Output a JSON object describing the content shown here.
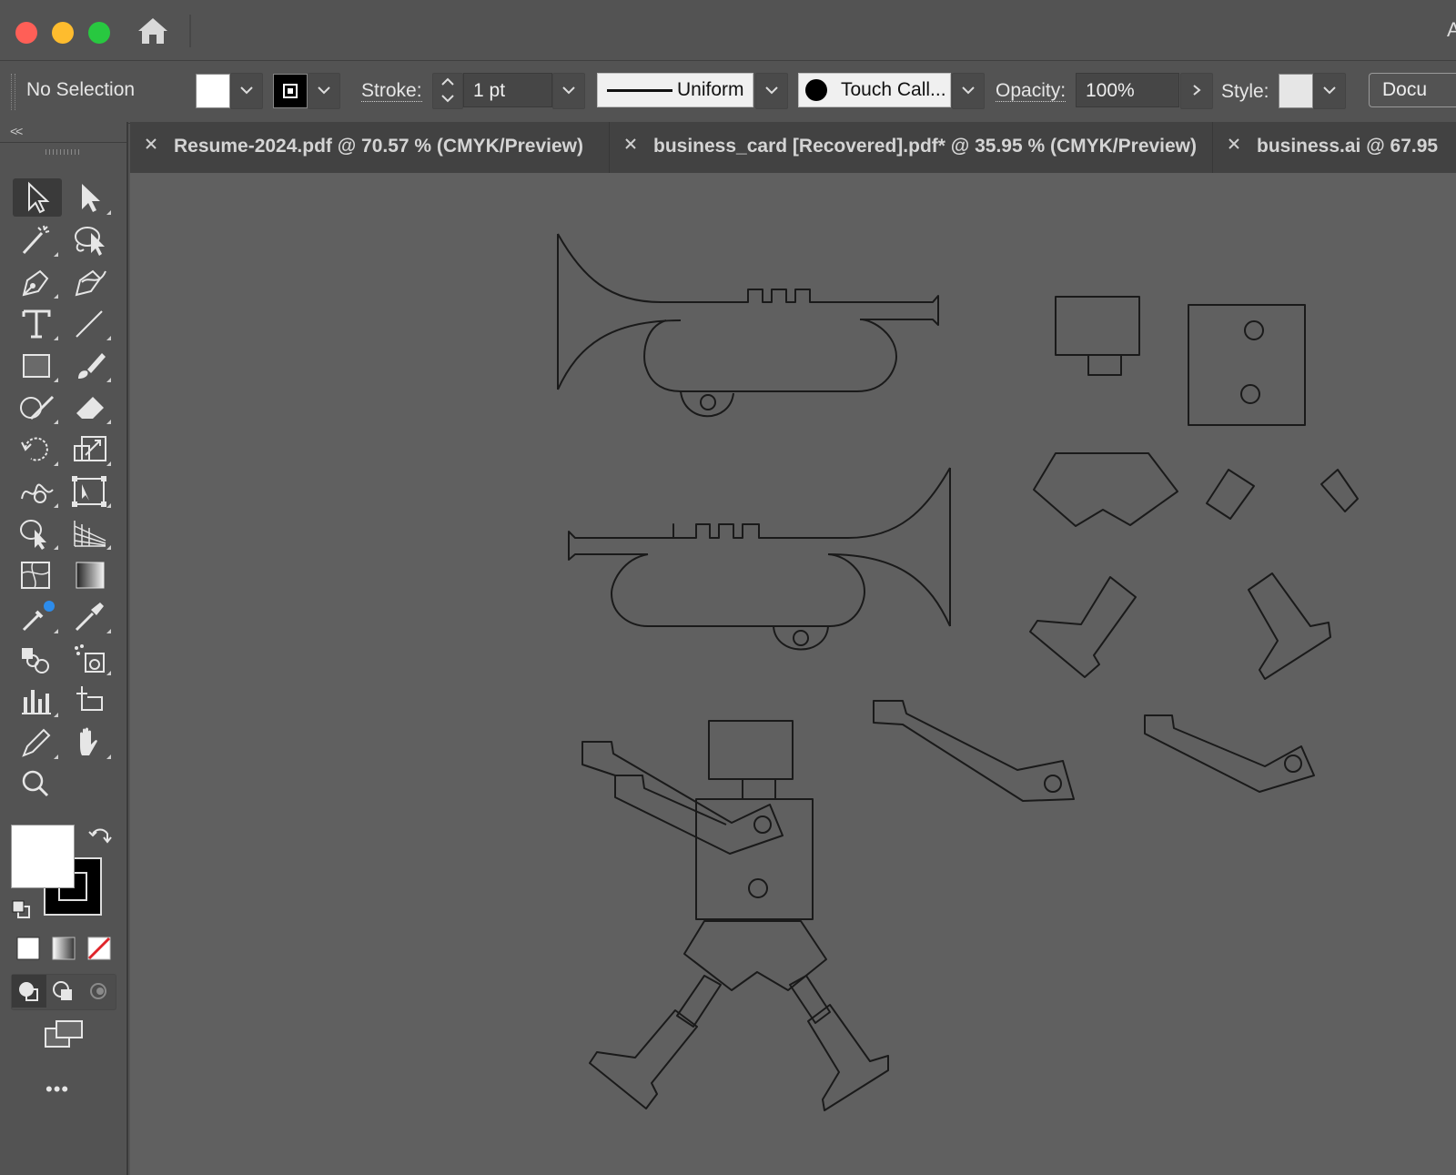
{
  "titlebar": {
    "home_icon": "home-icon",
    "edge_text": "A"
  },
  "control": {
    "selection_label": "No Selection",
    "stroke_label": "Stroke:",
    "stroke_value": "1 pt",
    "profile_label": "Uniform",
    "brush_label": "Touch Call...",
    "opacity_label": "Opacity:",
    "opacity_value": "100%",
    "style_label": "Style:",
    "document_button": "Docu"
  },
  "tabs": [
    {
      "label": "Resume-2024.pdf @ 70.57 % (CMYK/Preview)"
    },
    {
      "label": "business_card [Recovered].pdf* @ 35.95 % (CMYK/Preview)"
    },
    {
      "label": "business.ai @ 67.95"
    }
  ],
  "toolbar": {
    "collapse_label": "<<",
    "more_label": "•••",
    "tools": [
      "selection-tool-icon",
      "direct-selection-tool-icon",
      "magic-wand-tool-icon",
      "lasso-tool-icon",
      "pen-tool-icon",
      "curvature-tool-icon",
      "type-tool-icon",
      "line-segment-tool-icon",
      "rectangle-tool-icon",
      "paintbrush-tool-icon",
      "shaper-tool-icon",
      "eraser-tool-icon",
      "rotate-tool-icon",
      "scale-tool-icon",
      "warp-tool-icon",
      "free-transform-tool-icon",
      "shape-builder-tool-icon",
      "perspective-grid-tool-icon",
      "mesh-tool-icon",
      "gradient-tool-icon",
      "eyedropper-tool-icon",
      "measure-tool-icon",
      "blend-tool-icon",
      "symbol-sprayer-tool-icon",
      "column-graph-tool-icon",
      "artboard-tool-icon",
      "slice-tool-icon",
      "hand-tool-icon",
      "zoom-tool-icon"
    ]
  },
  "colors": {
    "app_bg": "#535353",
    "canvas_bg": "#606060",
    "tab_bar_bg": "#424242",
    "artwork_stroke": "#1a1a1a",
    "fill": "#ffffff",
    "stroke": "#000000"
  }
}
